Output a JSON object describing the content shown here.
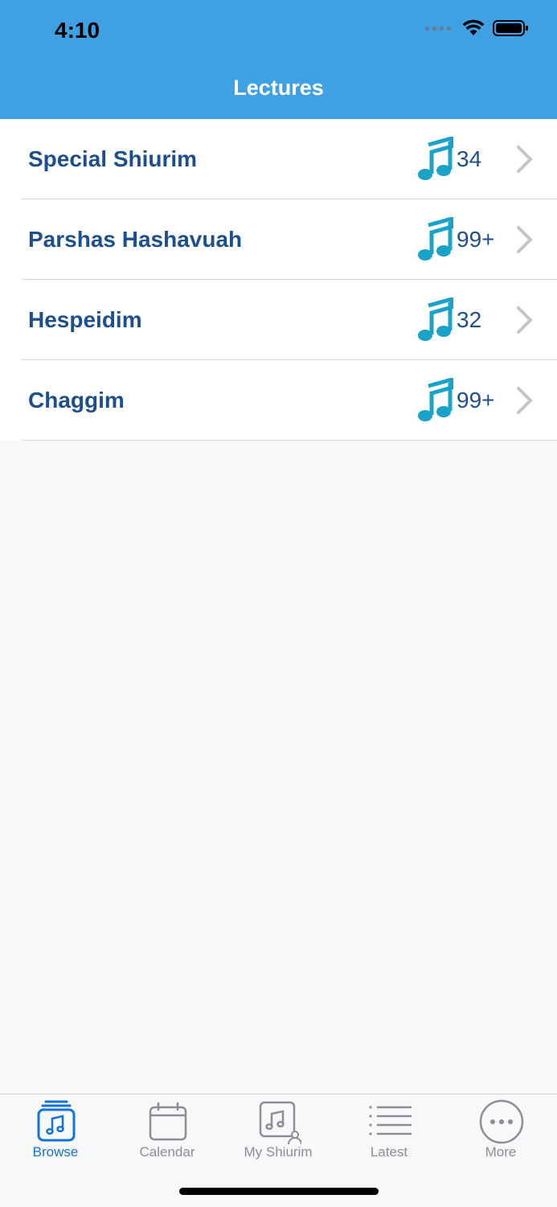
{
  "status_bar": {
    "time": "4:10"
  },
  "nav": {
    "title": "Lectures"
  },
  "list": {
    "items": [
      {
        "label": "Special Shiurim",
        "count": "34"
      },
      {
        "label": "Parshas Hashavuah",
        "count": "99+"
      },
      {
        "label": "Hespeidim",
        "count": "32"
      },
      {
        "label": "Chaggim",
        "count": "99+"
      }
    ],
    "icon": "music-note-icon"
  },
  "tabs": [
    {
      "label": "Browse",
      "icon": "music-library-icon",
      "active": true
    },
    {
      "label": "Calendar",
      "icon": "calendar-icon",
      "active": false
    },
    {
      "label": "My Shiurim",
      "icon": "my-music-icon",
      "active": false
    },
    {
      "label": "Latest",
      "icon": "list-icon",
      "active": false
    },
    {
      "label": "More",
      "icon": "more-icon",
      "active": false
    }
  ],
  "colors": {
    "header": "#3fa0e4",
    "row_text": "#1d4f8c",
    "note_icon": "#1aa3c8",
    "active_tab": "#1673d6",
    "inactive_tab": "#8e8e93"
  }
}
